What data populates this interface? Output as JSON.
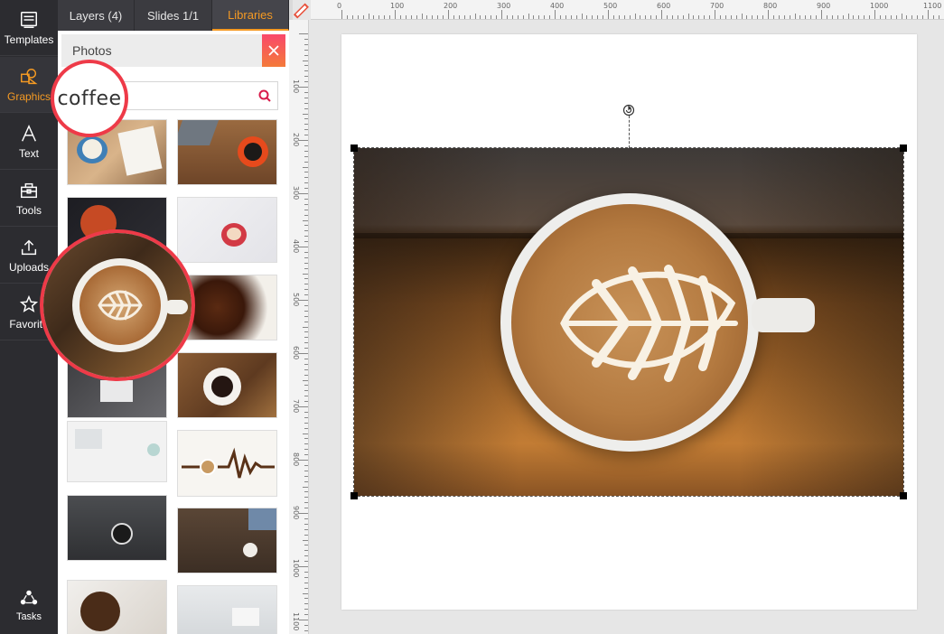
{
  "nav": {
    "items": [
      {
        "label": "Templates",
        "icon": "templates-icon"
      },
      {
        "label": "Graphics",
        "icon": "graphics-icon",
        "active": true
      },
      {
        "label": "Text",
        "icon": "text-icon"
      },
      {
        "label": "Tools",
        "icon": "toolbox-icon"
      },
      {
        "label": "Uploads",
        "icon": "upload-icon"
      },
      {
        "label": "Favorite",
        "icon": "star-icon"
      }
    ],
    "tasks_label": "Tasks"
  },
  "tabs": [
    {
      "label": "Layers (4)"
    },
    {
      "label": "Slides 1/1"
    },
    {
      "label": "Libraries",
      "active": true
    }
  ],
  "photos": {
    "title": "Photos",
    "search_value": "coffee",
    "callout_text": "coffee"
  },
  "ruler": {
    "h_labels": [
      "0",
      "100",
      "200",
      "300",
      "400",
      "500",
      "600",
      "700",
      "800",
      "900",
      "1000",
      "1100"
    ],
    "v_labels": [
      "100",
      "200",
      "300",
      "400",
      "500",
      "600",
      "700",
      "800",
      "900",
      "1000",
      "1100"
    ]
  },
  "colors": {
    "accent": "#f59a23",
    "close": "#f9486b",
    "callout": "#ee3a48",
    "rail": "#2c2c30"
  }
}
